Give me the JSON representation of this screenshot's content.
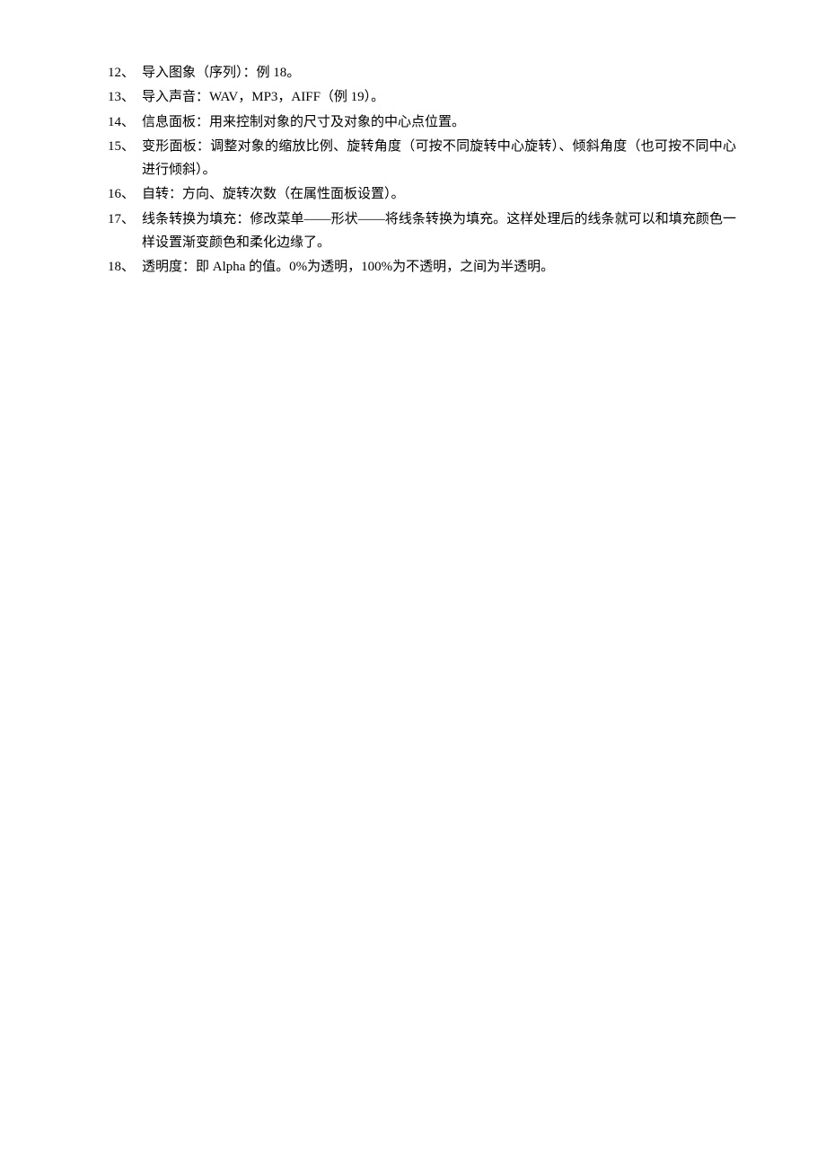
{
  "items": [
    {
      "num": "12、",
      "text": "导入图象（序列）：例 18。"
    },
    {
      "num": "13、",
      "text": "导入声音：WAV，MP3，AIFF（例 19）。"
    },
    {
      "num": "14、",
      "text": "信息面板：用来控制对象的尺寸及对象的中心点位置。"
    },
    {
      "num": "15、",
      "text": "变形面板：调整对象的缩放比例、旋转角度（可按不同旋转中心旋转）、倾斜角度（也可按不同中心进行倾斜）。"
    },
    {
      "num": "16、",
      "text": "自转：方向、旋转次数（在属性面板设置）。"
    },
    {
      "num": "17、",
      "text": "线条转换为填充：修改菜单——形状——将线条转换为填充。这样处理后的线条就可以和填充颜色一样设置渐变颜色和柔化边缘了。"
    },
    {
      "num": "18、",
      "text": "透明度：即 Alpha 的值。0%为透明，100%为不透明，之间为半透明。"
    }
  ]
}
